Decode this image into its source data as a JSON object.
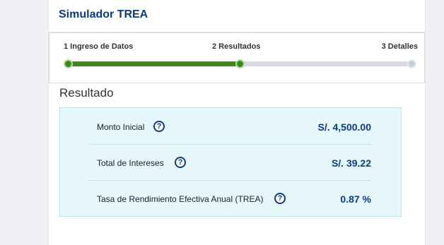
{
  "header": {
    "title": "Simulador TREA"
  },
  "stepper": {
    "steps": [
      {
        "label": "1 Ingreso de Datos",
        "state": "done"
      },
      {
        "label": "2 Resultados",
        "state": "current"
      },
      {
        "label": "3 Detalles",
        "state": "pending"
      }
    ],
    "progress_fraction": 0.5
  },
  "result": {
    "title": "Resultado",
    "help_glyph": "?",
    "rows": [
      {
        "label": "Monto Inicial",
        "value": "S/. 4,500.00"
      },
      {
        "label": "Total de Intereses",
        "value": "S/. 39.22"
      },
      {
        "label": "Tasa de Rendimiento Efectiva Anual (TREA)",
        "value": "0.87 %"
      }
    ]
  },
  "colors": {
    "brand_blue": "#0b3a7e",
    "progress_green": "#3d8a1c",
    "track_gray": "#d6dbe6",
    "result_bg": "#e5f7fb"
  },
  "icons": {
    "help": "question-circle-icon"
  }
}
